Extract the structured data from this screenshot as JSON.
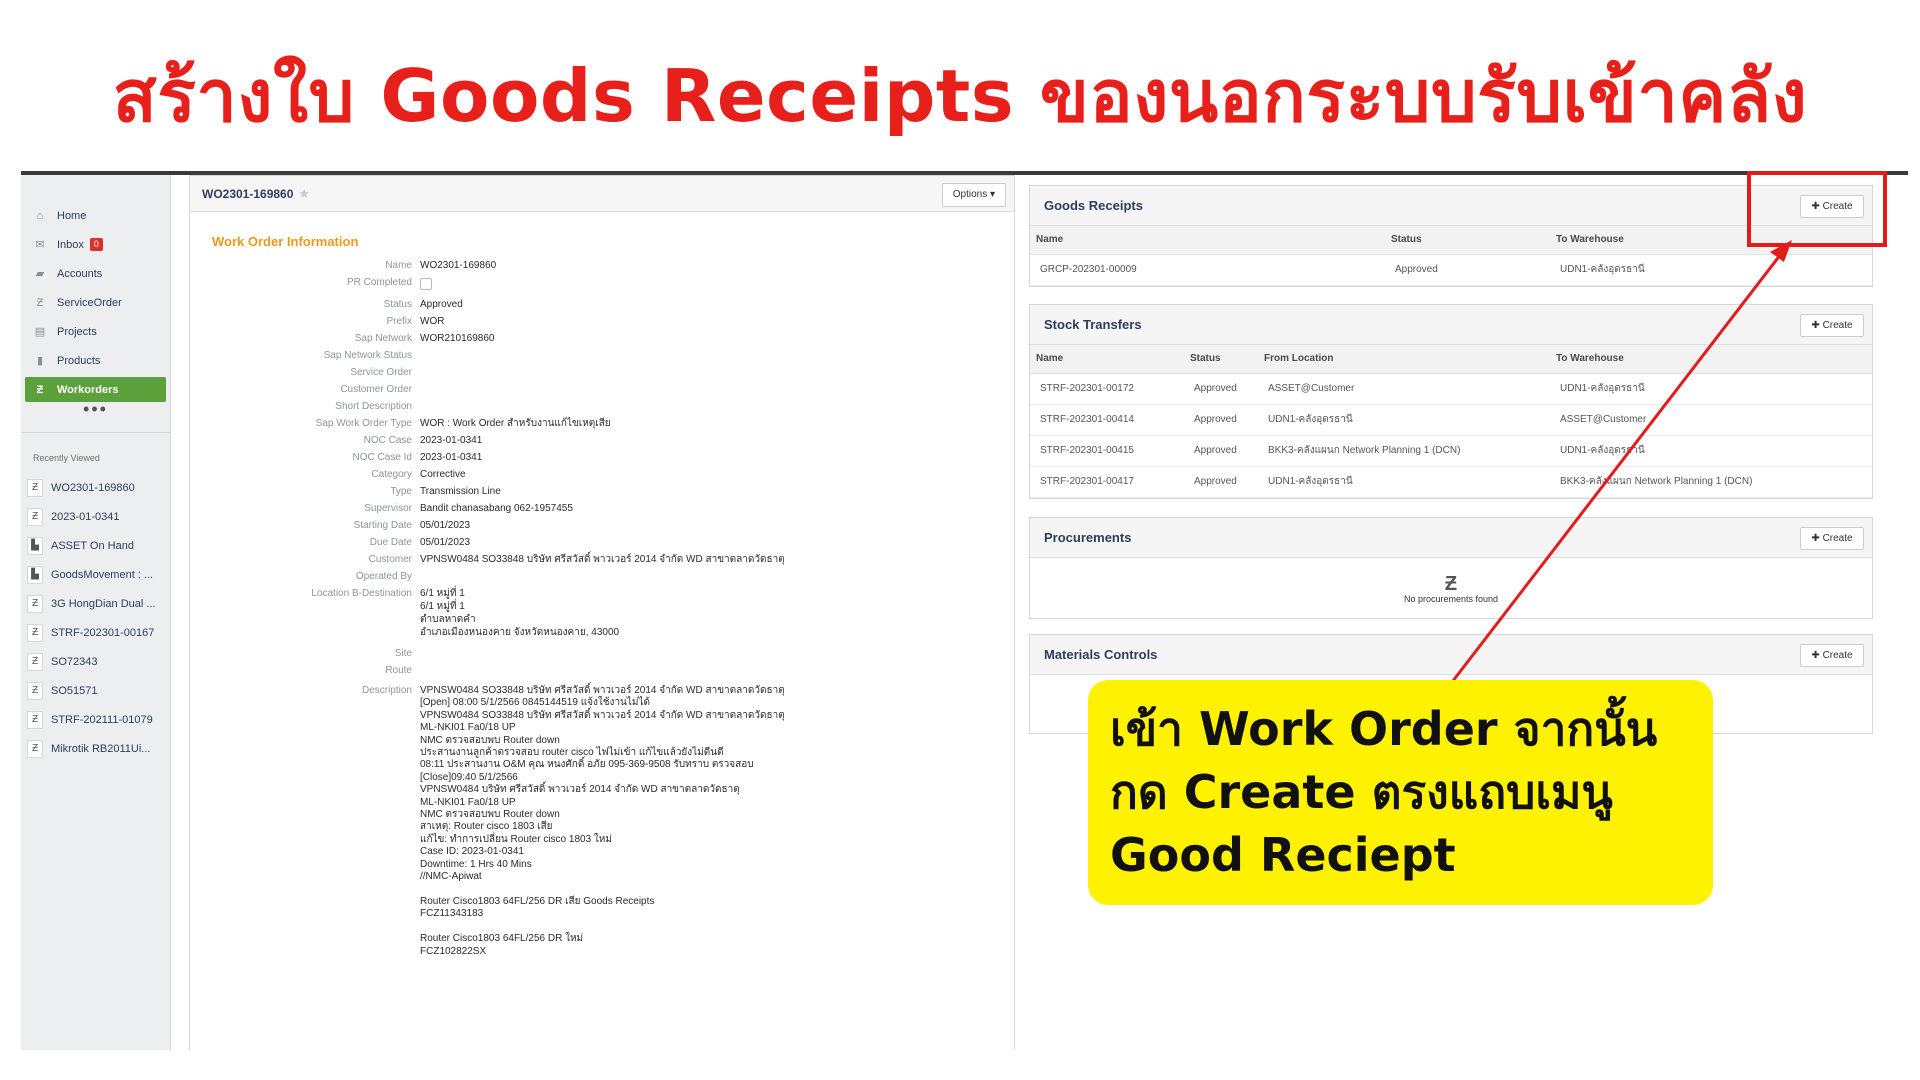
{
  "headline": "สร้างใบ Goods Receipts ของนอกระบบรับเข้าคลัง",
  "callout": "เข้า Work Order จากนั้น กด Create ตรงแถบเมนู Good Reciept",
  "colors": {
    "headline": "#e8201c",
    "active_nav": "#5ba03b",
    "section_title": "#e89a1a",
    "highlight": "#e21b1b",
    "callout_bg": "#fff200"
  },
  "sidebar": {
    "nav": [
      {
        "label": "Home",
        "icon": "home-icon"
      },
      {
        "label": "Inbox",
        "icon": "envelope-icon",
        "badge": "0"
      },
      {
        "label": "Accounts",
        "icon": "folder-icon"
      },
      {
        "label": "ServiceOrder",
        "icon": "z-logo-icon"
      },
      {
        "label": "Projects",
        "icon": "briefcase-icon"
      },
      {
        "label": "Products",
        "icon": "box-icon"
      },
      {
        "label": "Workorders",
        "icon": "z-logo-icon",
        "active": true
      }
    ],
    "more": "•••",
    "recently_viewed_title": "Recently Viewed",
    "recent": [
      {
        "label": "WO2301-169860",
        "icon": "z-logo-icon"
      },
      {
        "label": "2023-01-0341",
        "icon": "z-logo-icon"
      },
      {
        "label": "ASSET On Hand",
        "icon": "chart-icon"
      },
      {
        "label": "GoodsMovement : ...",
        "icon": "chart-icon"
      },
      {
        "label": "3G HongDian Dual ...",
        "icon": "z-logo-icon"
      },
      {
        "label": "STRF-202301-00167",
        "icon": "z-logo-icon"
      },
      {
        "label": "SO72343",
        "icon": "z-logo-icon"
      },
      {
        "label": "SO51571",
        "icon": "z-logo-icon"
      },
      {
        "label": "STRF-202111-01079",
        "icon": "z-logo-icon"
      },
      {
        "label": "Mikrotik RB2011Ui...",
        "icon": "z-logo-icon"
      }
    ]
  },
  "workorder": {
    "title": "WO2301-169860",
    "options_label": "Options ▾",
    "section_title": "Work Order Information",
    "fields": [
      {
        "label": "Name",
        "value": "WO2301-169860"
      },
      {
        "label": "PR Completed",
        "value": "",
        "checkbox": true
      },
      {
        "label": "Status",
        "value": "Approved"
      },
      {
        "label": "Prefix",
        "value": "WOR"
      },
      {
        "label": "Sap Network",
        "value": "WOR210169860"
      },
      {
        "label": "Sap Network Status",
        "value": ""
      },
      {
        "label": "Service Order",
        "value": ""
      },
      {
        "label": "Customer Order",
        "value": ""
      },
      {
        "label": "Short Description",
        "value": ""
      },
      {
        "label": "Sap Work Order Type",
        "value": "WOR : Work Order สำหรับงานแก้ไขเหตุเสีย"
      },
      {
        "label": "NOC Case",
        "value": "2023-01-0341"
      },
      {
        "label": "NOC Case Id",
        "value": "2023-01-0341"
      },
      {
        "label": "Category",
        "value": "Corrective"
      },
      {
        "label": "Type",
        "value": "Transmission Line"
      },
      {
        "label": "Supervisor",
        "value": "Bandit chanasabang 062-1957455"
      },
      {
        "label": "Starting Date",
        "value": "05/01/2023"
      },
      {
        "label": "Due Date",
        "value": "05/01/2023"
      },
      {
        "label": "Customer",
        "value": "VPNSW0484 SO33848 บริษัท ศรีสวัสดิ์ พาวเวอร์ 2014 จำกัด WD สาขาตลาดวัดธาตุ"
      },
      {
        "label": "Operated By",
        "value": ""
      },
      {
        "label": "Location B-Destination",
        "value": "6/1 หมู่ที่ 1\n6/1 หมู่ที่ 1\nตำบลหาดคำ\nอำเภอเมืองหนองคาย จังหวัดหนองคาย, 43000"
      },
      {
        "label": "Site",
        "value": ""
      },
      {
        "label": "Route",
        "value": ""
      },
      {
        "label": "Description",
        "value": "VPNSW0484 SO33848 บริษัท ศรีสวัสดิ์ พาวเวอร์ 2014 จำกัด WD สาขาตลาดวัดธาตุ\n[Open] 08:00 5/1/2566 0845144519 แจ้งใช้งานไม่ได้\nVPNSW0484 SO33848 บริษัท ศรีสวัสดิ์ พาวเวอร์ 2014 จำกัด WD สาขาตลาดวัดธาตุ\nML-NKI01 Fa0/18 UP\nNMC ตรวจสอบพบ Router down\nประสานงานลูกค้าตรวจสอบ router cisco ไฟไม่เข้า แก้ไขแล้วยังไม่ดีนดี\n08:11 ประสานงาน O&M คุณ หนงศักดิ์ อภัย 095-369-9508 รับทราบ ตรวจสอบ\n[Close]09:40 5/1/2566\nVPNSW0484 บริษัท ศรีสวัสดิ์ พาวเวอร์ 2014 จำกัด WD สาขาตลาดวัดธาตุ\nML-NKI01 Fa0/18 UP\nNMC ตรวจสอบพบ Router down\nสาเหตุ: Router cisco 1803 เสีย\nแก้ไข: ทำการเปลี่ยน Router cisco 1803 ใหม่\nCase ID: 2023-01-0341\nDowntime: 1 Hrs 40 Mins\n//NMC-Apiwat\n\nRouter Cisco1803 64FL/256 DR เสีย Goods Receipts\nFCZ11343183\n\nRouter Cisco1803 64FL/256 DR ใหม่\nFCZ102822SX"
      }
    ]
  },
  "create_label": "✚ Create",
  "goods_receipts": {
    "title": "Goods Receipts",
    "columns": [
      "Name",
      "Status",
      "To Warehouse"
    ],
    "rows": [
      [
        "GRCP-202301-00009",
        "Approved",
        "UDN1-คลังอุดรธานี"
      ]
    ]
  },
  "stock_transfers": {
    "title": "Stock Transfers",
    "columns": [
      "Name",
      "Status",
      "From Location",
      "To Warehouse"
    ],
    "rows": [
      [
        "STRF-202301-00172",
        "Approved",
        "ASSET@Customer",
        "UDN1-คลังอุดรธานี"
      ],
      [
        "STRF-202301-00414",
        "Approved",
        "UDN1-คลังอุดรธานี",
        "ASSET@Customer"
      ],
      [
        "STRF-202301-00415",
        "Approved",
        "BKK3-คลังแผนก Network Planning 1 (DCN)",
        "UDN1-คลังอุดรธานี"
      ],
      [
        "STRF-202301-00417",
        "Approved",
        "UDN1-คลังอุดรธานี",
        "BKK3-คลังแผนก Network Planning 1 (DCN)"
      ]
    ]
  },
  "procurements": {
    "title": "Procurements",
    "empty_icon": "Ƶ",
    "empty_text": "No procurements found"
  },
  "materials_controls": {
    "title": "Materials Controls"
  }
}
